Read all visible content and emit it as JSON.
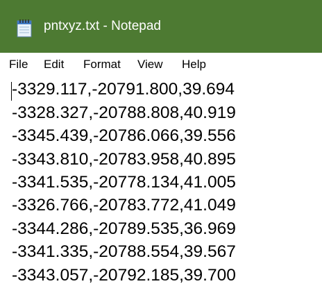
{
  "window": {
    "title": "pntxyz.txt - Notepad",
    "icon": "notepad-icon",
    "titlebar_color": "#4d7a32"
  },
  "menu": {
    "items": [
      "File",
      "Edit",
      "Format",
      "View",
      "Help"
    ]
  },
  "editor": {
    "lines": [
      "-3329.117,-20791.800,39.694",
      "-3328.327,-20788.808,40.919",
      "-3345.439,-20786.066,39.556",
      "-3343.810,-20783.958,40.895",
      "-3341.535,-20778.134,41.005",
      "-3326.766,-20783.772,41.049",
      "-3344.286,-20789.535,36.969",
      "-3341.335,-20788.554,39.567",
      "-3343.057,-20792.185,39.700"
    ]
  }
}
